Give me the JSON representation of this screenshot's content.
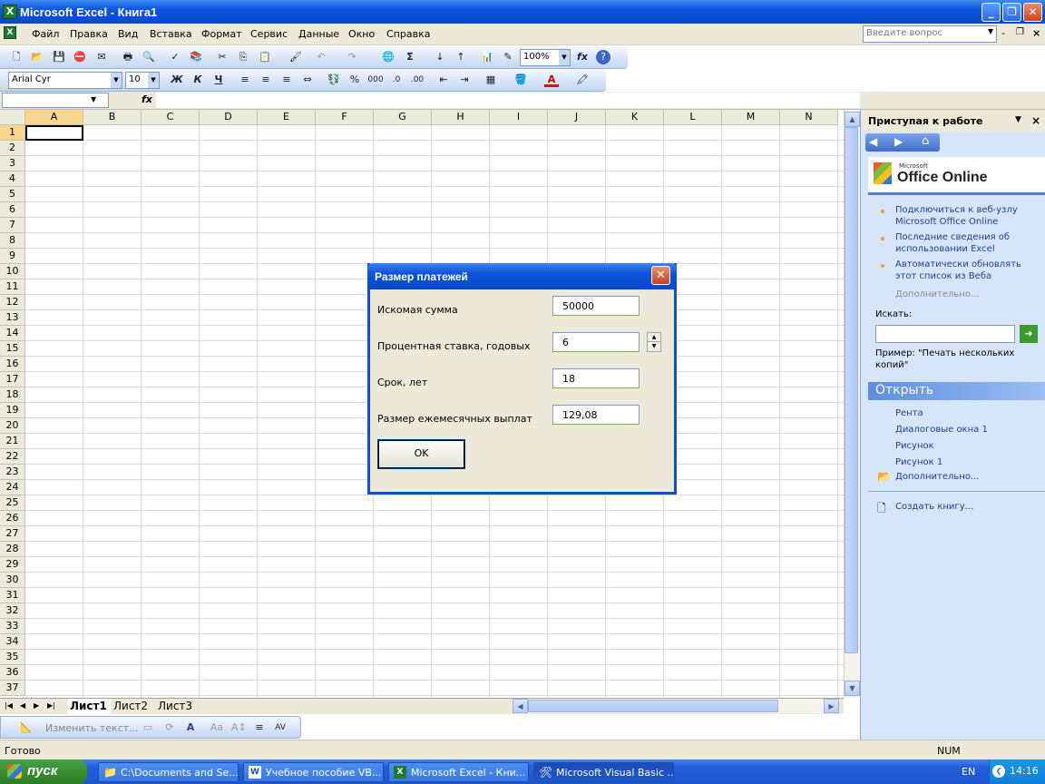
{
  "window": {
    "title": "Microsoft Excel - Книга1"
  },
  "menu": {
    "items": [
      "Файл",
      "Правка",
      "Вид",
      "Вставка",
      "Формат",
      "Сервис",
      "Данные",
      "Окно",
      "Справка"
    ],
    "ask_placeholder": "Введите вопрос"
  },
  "toolbar": {
    "zoom": "100%",
    "fx": "fx"
  },
  "format": {
    "font": "Arial Cyr",
    "size": "10",
    "bold": "Ж",
    "italic": "К",
    "underline": "Ч",
    "percent": "%",
    "thousands": "000"
  },
  "grid": {
    "columns": [
      "A",
      "B",
      "C",
      "D",
      "E",
      "F",
      "G",
      "H",
      "I",
      "J",
      "K",
      "L",
      "M",
      "N"
    ],
    "rows": [
      "1",
      "2",
      "3",
      "4",
      "5",
      "6",
      "7",
      "8",
      "9",
      "10",
      "11",
      "12",
      "13",
      "14",
      "15",
      "16",
      "17",
      "18",
      "19",
      "20",
      "21",
      "22",
      "23",
      "24",
      "25",
      "26",
      "27",
      "28",
      "29",
      "30",
      "31",
      "32",
      "33",
      "34",
      "35",
      "36",
      "37"
    ],
    "active_cell": "A1"
  },
  "sheets": [
    "Лист1",
    "Лист2",
    "Лист3"
  ],
  "drawing": {
    "change_text": "Изменить текст..."
  },
  "status": {
    "ready": "Готово",
    "num": "NUM"
  },
  "taskpane": {
    "title": "Приступая к работе",
    "brand_small": "Microsoft",
    "brand": "Office Online",
    "links": [
      "Подключиться к веб-узлу Microsoft Office Online",
      "Последние сведения об использовании Excel",
      "Автоматически обновлять этот список из Веба"
    ],
    "more": "Дополнительно...",
    "search_label": "Искать:",
    "example": "Пример:  \"Печать нескольких копий\"",
    "open_title": "Открыть",
    "recent": [
      "Рента",
      "Диалоговые окна 1",
      "Рисунок",
      "Рисунок 1"
    ],
    "open_more": "Дополнительно...",
    "create": "Создать книгу..."
  },
  "dialog": {
    "title": "Размер платежей",
    "fields": [
      {
        "label": "Искомая сумма",
        "value": "50000"
      },
      {
        "label": "Процентная ставка, годовых",
        "value": "6"
      },
      {
        "label": "Срок, лет",
        "value": "18"
      },
      {
        "label": "Размер ежемесячных выплат",
        "value": "129,08"
      }
    ],
    "ok": "OK"
  },
  "taskbar": {
    "start": "пуск",
    "tasks": [
      "C:\\Documents and Se...",
      "Учебное пособие VB...",
      "Microsoft Excel - Кни...",
      "Microsoft Visual Basic ..."
    ],
    "lang": "EN",
    "time": "14:16"
  }
}
